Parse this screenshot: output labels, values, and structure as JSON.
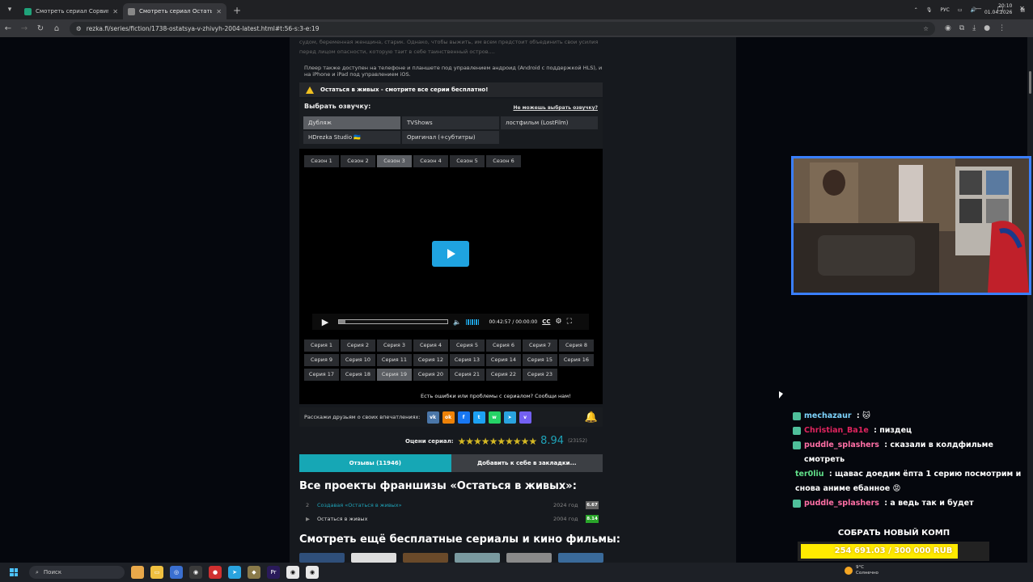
{
  "browser": {
    "tabs": [
      {
        "title": "Смотреть сериал Сорвиголов",
        "active": false,
        "favicon_color": "#1fa37a"
      },
      {
        "title": "Смотреть сериал Остаться в жи",
        "active": true,
        "favicon_color": "#888888"
      }
    ],
    "url": "rezka.fi/series/fiction/1738-ostatsya-v-zhivyh-2004-latest.html#t:56-s:3-e:19"
  },
  "page": {
    "description": "судом, беременная женщина, старик. Однако, чтобы выжить, им всем предстоит объединить свои усилия перед лицом опасности, которую таит в себе таинственный остров....",
    "availability": "Плеер также доступен на телефоне и планшете под управлением андроид (Android с поддержкой HLS), и на iPhone и iPad под управлением iOS.",
    "free_banner": "Остаться в живых - смотрите все серии бесплатно!",
    "voice": {
      "heading": "Выбрать озвучку:",
      "help_link": "Не можешь выбрать озвучку?",
      "options": [
        "Дубляж",
        "TVShows",
        "лостфильм (LostFilm)",
        "HDrezka Studio 🇺🇦",
        "Оригинал (+субтитры)"
      ],
      "selected": "Дубляж"
    },
    "seasons": [
      "Сезон 1",
      "Сезон 2",
      "Сезон 3",
      "Сезон 4",
      "Сезон 5",
      "Сезон 6"
    ],
    "selected_season": "Сезон 3",
    "controls": {
      "time": "00:42:57 / 00:00:00",
      "cc": "CC",
      "progress": 0.06
    },
    "episodes": [
      "Серия 1",
      "Серия 2",
      "Серия 3",
      "Серия 4",
      "Серия 5",
      "Серия 6",
      "Серия 7",
      "Серия 8",
      "Серия 9",
      "Серия 10",
      "Серия 11",
      "Серия 12",
      "Серия 13",
      "Серия 14",
      "Серия 15",
      "Серия 16",
      "Серия 17",
      "Серия 18",
      "Серия 19",
      "Серия 20",
      "Серия 21",
      "Серия 22",
      "Серия 23"
    ],
    "selected_episode": "Серия 19",
    "error_report": "Есть ошибки или проблемы с сериалом? Сообщи нам!",
    "share_label": "Расскажи друзьям о своих впечатлениях:",
    "social": [
      {
        "name": "vk",
        "glyph": "vk",
        "color": "#4a76a8"
      },
      {
        "name": "ok",
        "glyph": "ok",
        "color": "#ee8208"
      },
      {
        "name": "facebook",
        "glyph": "f",
        "color": "#1877f2"
      },
      {
        "name": "twitter",
        "glyph": "t",
        "color": "#1da1f2"
      },
      {
        "name": "whatsapp",
        "glyph": "w",
        "color": "#25d366"
      },
      {
        "name": "telegram",
        "glyph": "➤",
        "color": "#2aa3df"
      },
      {
        "name": "viber",
        "glyph": "v",
        "color": "#7360f2"
      }
    ],
    "rating": {
      "label": "Оцени сериал:",
      "stars": "★★★★★★★★★★",
      "score": "8.94",
      "votes": "(23152)"
    },
    "reviews_tab": "Отзывы (11946)",
    "bookmark_tab": "Добавить к себе в закладки...",
    "franchise_title": "Все проекты франшизы «Остаться в живых»:",
    "franchise": [
      {
        "num": "2",
        "name": "Создавая «Остаться в живых»",
        "year": "2024 год",
        "score": "6.67",
        "color": "#666666",
        "link_color": "#1fa3b8"
      },
      {
        "num": "▶",
        "name": "Остаться в живых",
        "year": "2004 год",
        "score": "8.14",
        "color": "#2aa52a",
        "link_color": "#dddddd"
      }
    ],
    "more_title": "Смотреть ещё бесплатные сериалы и кино фильмы:"
  },
  "stream": {
    "chat": [
      {
        "user": "mechazaur",
        "color": "#7dd3fc",
        "msg": "🐱",
        "badge": true
      },
      {
        "user": "Christian_Ba1e",
        "color": "#e0245e",
        "msg": "пиздец",
        "badge": true
      },
      {
        "user": "puddle_splashers",
        "color": "#ff6fa5",
        "msg": "сказали в колдфильме смотреть",
        "badge": true
      },
      {
        "user": "ter0liu",
        "color": "#61e08a",
        "msg": "щавас доедим ёпта 1 серию посмотрим и снова аниме ебанное 😡",
        "badge": false
      },
      {
        "user": "puddle_splashers",
        "color": "#ff6fa5",
        "msg": "а ведь так и будет",
        "badge": true
      }
    ],
    "goal_title": "СОБРАТЬ НОВЫЙ КОМП",
    "goal_text": "254 691.03 / 300 000 RUB",
    "goal_fraction": 0.849
  },
  "taskbar": {
    "search": "Поиск",
    "weather_temp": "9°C",
    "weather_desc": "Солнечно",
    "lang": "РУС",
    "time": "20:10",
    "date": "01.04.2026"
  }
}
